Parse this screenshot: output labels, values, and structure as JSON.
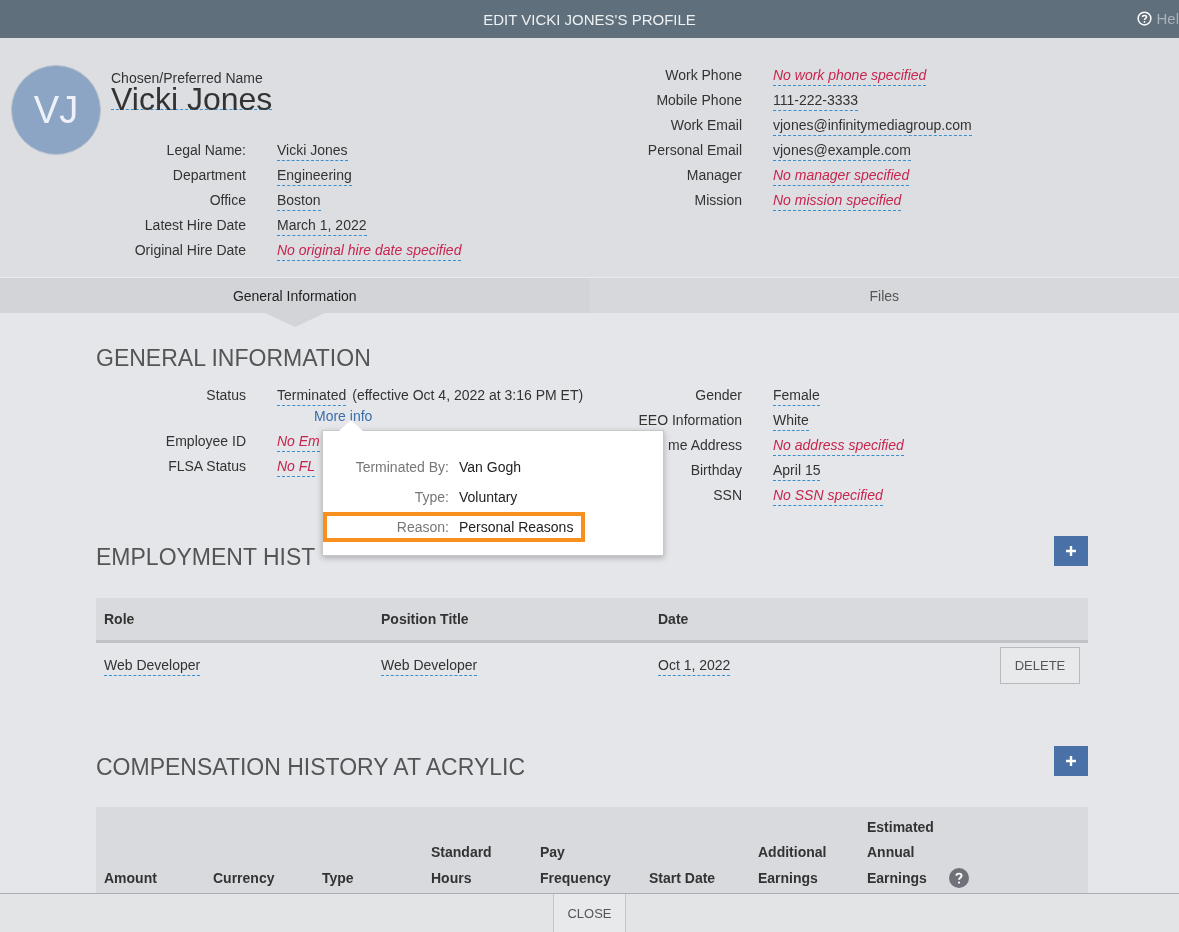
{
  "window": {
    "title": "EDIT VICKI JONES'S PROFILE",
    "help": "Hel"
  },
  "profile": {
    "initials": "VJ",
    "name_label": "Chosen/Preferred Name",
    "name": "Vicki Jones",
    "left_fields": [
      {
        "label": "Legal Name:",
        "value": "Vicki Jones",
        "specified": true
      },
      {
        "label": "Department",
        "value": "Engineering",
        "specified": true
      },
      {
        "label": "Office",
        "value": "Boston",
        "specified": true
      },
      {
        "label": "Latest Hire Date",
        "value": "March 1, 2022",
        "specified": true
      },
      {
        "label": "Original Hire Date",
        "value": "No original hire date specified",
        "specified": false
      }
    ],
    "right_fields": [
      {
        "label": "Work Phone",
        "value": "No work phone specified",
        "specified": false
      },
      {
        "label": "Mobile Phone",
        "value": "111-222-3333",
        "specified": true
      },
      {
        "label": "Work Email",
        "value": "vjones@infinitymediagroup.com",
        "specified": true
      },
      {
        "label": "Personal Email",
        "value": "vjones@example.com",
        "specified": true
      },
      {
        "label": "Manager",
        "value": "No manager specified",
        "specified": false
      },
      {
        "label": "Mission",
        "value": "No mission specified",
        "specified": false
      }
    ]
  },
  "tabs": [
    {
      "label": "General Information",
      "selected": true
    },
    {
      "label": "Files",
      "selected": false
    }
  ],
  "general": {
    "title": "GENERAL INFORMATION",
    "status": {
      "label": "Status",
      "value": "Terminated",
      "note": "(effective Oct 4, 2022 at 3:16 PM ET)",
      "link": "More info"
    },
    "left_fields": [
      {
        "label": "Employee ID",
        "value": "No Em",
        "specified": false
      },
      {
        "label": "FLSA Status",
        "value": "No FL",
        "specified": false
      }
    ],
    "right_fields": [
      {
        "label": "Gender",
        "value": "Female",
        "specified": true
      },
      {
        "label": "EEO Information",
        "value": "White",
        "specified": true
      },
      {
        "label": "me Address",
        "value": "No address specified",
        "specified": false
      },
      {
        "label": "Birthday",
        "value": "April 15",
        "specified": true
      },
      {
        "label": "SSN",
        "value": "No SSN specified",
        "specified": false
      }
    ]
  },
  "popover": {
    "rows": [
      {
        "label": "Terminated By:",
        "value": "Van Gogh",
        "highlighted": false
      },
      {
        "label": "Type:",
        "value": "Voluntary",
        "highlighted": false
      },
      {
        "label": "Reason:",
        "value": "Personal Reasons",
        "highlighted": true
      }
    ]
  },
  "employment": {
    "title": "EMPLOYMENT HIST",
    "columns": [
      "Role",
      "Position Title",
      "Date"
    ],
    "rows": [
      {
        "cells": [
          "Web Developer",
          "Web Developer",
          "Oct 1, 2022"
        ],
        "action": "DELETE"
      }
    ]
  },
  "compensation": {
    "title": "COMPENSATION HISTORY AT ACRYLIC",
    "columns": [
      "Amount",
      "Currency",
      "Type",
      "Standard Hours",
      "Pay Frequency",
      "Start Date",
      "Additional Earnings",
      "Estimated Annual Earnings"
    ]
  },
  "footer": {
    "button": "CLOSE"
  }
}
